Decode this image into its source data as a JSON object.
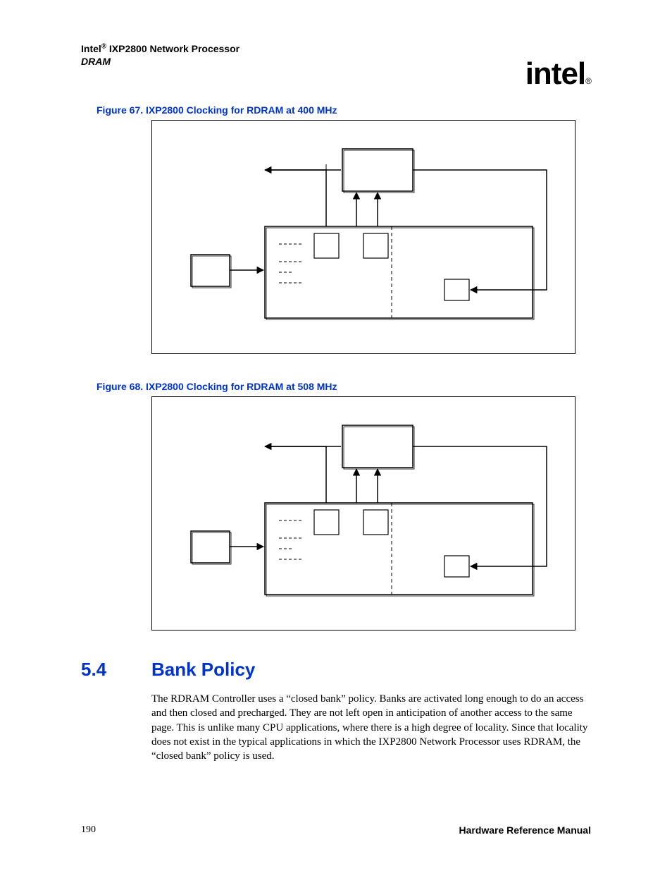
{
  "header": {
    "product_prefix": "Intel",
    "product_reg": "®",
    "product_suffix": " IXP2800 Network Processor",
    "subtitle": "DRAM",
    "logo_text": "intel",
    "logo_reg": "®"
  },
  "figures": {
    "fig67_caption": "Figure 67. IXP2800 Clocking for RDRAM at 400 MHz",
    "fig68_caption": "Figure 68. IXP2800 Clocking for RDRAM at 508 MHz"
  },
  "section": {
    "number": "5.4",
    "title": "Bank Policy",
    "body": "The RDRAM Controller uses a “closed bank” policy. Banks are activated long enough to do an access and then closed and precharged. They are not left open in anticipation of another access to the same page. This is unlike many CPU applications, where there is a high degree of locality. Since that locality does not exist in the typical applications in which the IXP2800 Network Processor uses RDRAM, the “closed bank” policy is used."
  },
  "footer": {
    "page_number": "190",
    "manual_title": "Hardware Reference Manual"
  }
}
